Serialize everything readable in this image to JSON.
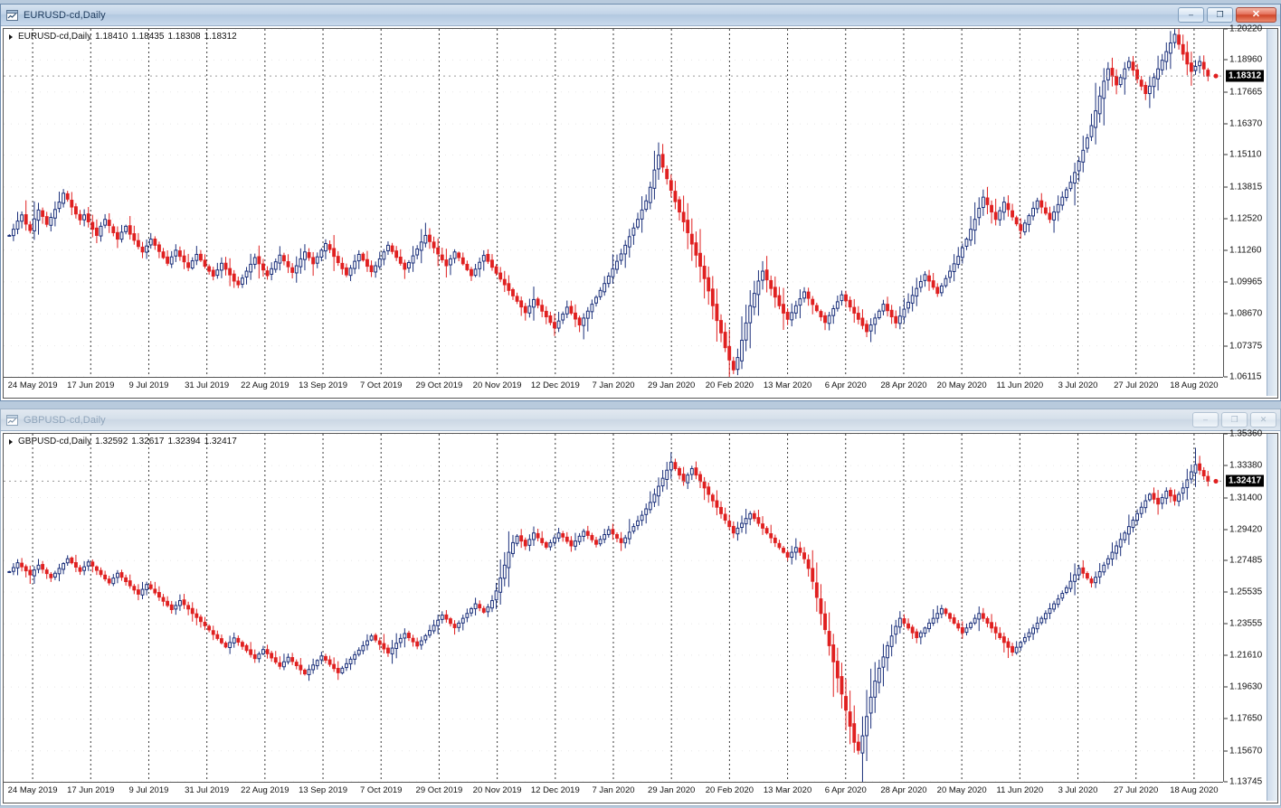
{
  "app": {
    "background_color": "#b8cadd",
    "candle_bull_color": "#1a2f7a",
    "candle_bear_color": "#e02020"
  },
  "windows": [
    {
      "id": "eurusd",
      "active": true,
      "title": "EURUSD-cd,Daily",
      "icon_name": "chart-window-icon",
      "buttons": {
        "minimize": "–",
        "restore": "❐",
        "close": "✕"
      },
      "ohlc": {
        "symbol_label": "EURUSD-cd,Daily",
        "open": "1.18410",
        "high": "1.18435",
        "low": "1.18308",
        "close": "1.18312"
      },
      "current_price": "1.18312",
      "price_labels": [
        "1.20220",
        "1.18960",
        "1.17665",
        "1.16370",
        "1.15110",
        "1.13815",
        "1.12520",
        "1.11260",
        "1.09965",
        "1.08670",
        "1.07375",
        "1.06115"
      ],
      "time_labels": [
        "24 May 2019",
        "17 Jun 2019",
        "9 Jul 2019",
        "31 Jul 2019",
        "22 Aug 2019",
        "13 Sep 2019",
        "7 Oct 2019",
        "29 Oct 2019",
        "20 Nov 2019",
        "12 Dec 2019",
        "7 Jan 2020",
        "29 Jan 2020",
        "20 Feb 2020",
        "13 Mar 2020",
        "6 Apr 2020",
        "28 Apr 2020",
        "20 May 2020",
        "11 Jun 2020",
        "3 Jul 2020",
        "27 Jul 2020",
        "18 Aug 2020"
      ]
    },
    {
      "id": "gbpusd",
      "active": false,
      "title": "GBPUSD-cd,Daily",
      "icon_name": "chart-window-icon",
      "buttons": {
        "minimize": "–",
        "restore": "❐",
        "close": "✕"
      },
      "ohlc": {
        "symbol_label": "GBPUSD-cd,Daily",
        "open": "1.32592",
        "high": "1.32617",
        "low": "1.32394",
        "close": "1.32417"
      },
      "current_price": "1.32417",
      "price_labels": [
        "1.35360",
        "1.33380",
        "1.31400",
        "1.29420",
        "1.27485",
        "1.25535",
        "1.23555",
        "1.21610",
        "1.19630",
        "1.17650",
        "1.15670",
        "1.13745"
      ],
      "time_labels": [
        "24 May 2019",
        "17 Jun 2019",
        "9 Jul 2019",
        "31 Jul 2019",
        "22 Aug 2019",
        "13 Sep 2019",
        "7 Oct 2019",
        "29 Oct 2019",
        "20 Nov 2019",
        "12 Dec 2019",
        "7 Jan 2020",
        "29 Jan 2020",
        "20 Feb 2020",
        "13 Mar 2020",
        "6 Apr 2020",
        "28 Apr 2020",
        "20 May 2020",
        "11 Jun 2020",
        "3 Jul 2020",
        "27 Jul 2020",
        "18 Aug 2020"
      ]
    }
  ],
  "chart_data": [
    {
      "type": "line",
      "chart_style": "candlestick",
      "title": "EURUSD-cd,Daily",
      "xlabel": "",
      "ylabel": "",
      "ylim": [
        1.06115,
        1.2022
      ],
      "grid": true,
      "legend": "none",
      "x_tick_labels": [
        "24 May 2019",
        "17 Jun 2019",
        "9 Jul 2019",
        "31 Jul 2019",
        "22 Aug 2019",
        "13 Sep 2019",
        "7 Oct 2019",
        "29 Oct 2019",
        "20 Nov 2019",
        "12 Dec 2019",
        "7 Jan 2020",
        "29 Jan 2020",
        "20 Feb 2020",
        "13 Mar 2020",
        "6 Apr 2020",
        "28 Apr 2020",
        "20 May 2020",
        "11 Jun 2020",
        "3 Jul 2020",
        "27 Jul 2020",
        "18 Aug 2020"
      ],
      "y_tick_labels": [
        "1.20220",
        "1.18960",
        "1.17665",
        "1.16370",
        "1.15110",
        "1.13815",
        "1.12520",
        "1.11260",
        "1.09965",
        "1.08670",
        "1.07375",
        "1.06115"
      ],
      "last_close": 1.18312,
      "close_series": [
        1.1185,
        1.121,
        1.1243,
        1.1268,
        1.1231,
        1.1205,
        1.1252,
        1.1288,
        1.1262,
        1.123,
        1.1258,
        1.129,
        1.132,
        1.1356,
        1.1332,
        1.13,
        1.1272,
        1.1248,
        1.1268,
        1.124,
        1.121,
        1.1185,
        1.1222,
        1.125,
        1.1225,
        1.1196,
        1.117,
        1.1198,
        1.1222,
        1.119,
        1.1165,
        1.114,
        1.1118,
        1.1142,
        1.117,
        1.1145,
        1.112,
        1.1095,
        1.1072,
        1.1098,
        1.1125,
        1.11,
        1.1078,
        1.1055,
        1.1082,
        1.1108,
        1.1085,
        1.106,
        1.104,
        1.102,
        1.1045,
        1.1072,
        1.1048,
        1.1025,
        1.1,
        1.0985,
        1.1012,
        1.104,
        1.1068,
        1.1095,
        1.107,
        1.1045,
        1.1022,
        1.105,
        1.1078,
        1.1105,
        1.1082,
        1.1058,
        1.1035,
        1.1062,
        1.109,
        1.1118,
        1.1095,
        1.107,
        1.1098,
        1.1125,
        1.1152,
        1.1128,
        1.11,
        1.1075,
        1.105,
        1.1025,
        1.1052,
        1.108,
        1.1108,
        1.1085,
        1.106,
        1.1038,
        1.1062,
        1.109,
        1.1118,
        1.1145,
        1.112,
        1.1096,
        1.1072,
        1.1048,
        1.1075,
        1.1102,
        1.113,
        1.1158,
        1.1185,
        1.116,
        1.1135,
        1.111,
        1.1086,
        1.1062,
        1.109,
        1.1118,
        1.1095,
        1.107,
        1.1046,
        1.1022,
        1.1048,
        1.1076,
        1.1104,
        1.108,
        1.1056,
        1.1032,
        1.1008,
        1.0985,
        1.0962,
        1.094,
        1.0918,
        1.0895,
        1.0872,
        1.0898,
        1.0925,
        1.0902,
        1.0878,
        1.0855,
        1.0832,
        1.081,
        1.0838,
        1.0866,
        1.0894,
        1.087,
        1.0846,
        1.0822,
        1.085,
        1.0878,
        1.0906,
        1.0934,
        1.0962,
        1.099,
        1.102,
        1.105,
        1.108,
        1.111,
        1.1145,
        1.118,
        1.1215,
        1.125,
        1.1288,
        1.1325,
        1.138,
        1.145,
        1.151,
        1.1462,
        1.1415,
        1.1368,
        1.1322,
        1.128,
        1.124,
        1.1196,
        1.115,
        1.1105,
        1.106,
        1.101,
        1.096,
        1.09,
        1.084,
        1.079,
        1.073,
        1.068,
        1.064,
        1.069,
        1.076,
        1.083,
        1.09,
        1.095,
        1.1,
        1.104,
        1.1005,
        1.097,
        1.0935,
        1.09,
        1.087,
        1.0845,
        1.0872,
        1.09,
        1.0928,
        1.0956,
        1.093,
        1.0905,
        1.088,
        1.0855,
        1.0832,
        1.086,
        1.0888,
        1.0916,
        1.0944,
        1.092,
        1.0895,
        1.087,
        1.0845,
        1.082,
        1.0795,
        1.0822,
        1.085,
        1.0878,
        1.0906,
        1.088,
        1.0855,
        1.083,
        1.0858,
        1.0886,
        1.0914,
        1.0942,
        1.097,
        1.0998,
        1.1026,
        1.1,
        1.0975,
        1.095,
        1.098,
        1.101,
        1.104,
        1.107,
        1.11,
        1.1135,
        1.117,
        1.121,
        1.125,
        1.1295,
        1.134,
        1.131,
        1.128,
        1.125,
        1.1285,
        1.132,
        1.129,
        1.126,
        1.1232,
        1.1205,
        1.1235,
        1.1265,
        1.1295,
        1.1325,
        1.13,
        1.1275,
        1.125,
        1.128,
        1.131,
        1.134,
        1.137,
        1.14,
        1.144,
        1.1485,
        1.153,
        1.158,
        1.163,
        1.169,
        1.175,
        1.181,
        1.186,
        1.183,
        1.1795,
        1.1825,
        1.186,
        1.189,
        1.1855,
        1.182,
        1.179,
        1.176,
        1.179,
        1.1825,
        1.186,
        1.1895,
        1.193,
        1.1965,
        1.2,
        1.196,
        1.192,
        1.188,
        1.185,
        1.187,
        1.189,
        1.186,
        1.1831
      ]
    },
    {
      "type": "line",
      "chart_style": "candlestick",
      "title": "GBPUSD-cd,Daily",
      "xlabel": "",
      "ylabel": "",
      "ylim": [
        1.13745,
        1.3536
      ],
      "grid": true,
      "legend": "none",
      "x_tick_labels": [
        "24 May 2019",
        "17 Jun 2019",
        "9 Jul 2019",
        "31 Jul 2019",
        "22 Aug 2019",
        "13 Sep 2019",
        "7 Oct 2019",
        "29 Oct 2019",
        "20 Nov 2019",
        "12 Dec 2019",
        "7 Jan 2020",
        "29 Jan 2020",
        "20 Feb 2020",
        "13 Mar 2020",
        "6 Apr 2020",
        "28 Apr 2020",
        "20 May 2020",
        "11 Jun 2020",
        "3 Jul 2020",
        "27 Jul 2020",
        "18 Aug 2020"
      ],
      "y_tick_labels": [
        "1.35360",
        "1.33380",
        "1.31400",
        "1.29420",
        "1.27485",
        "1.25535",
        "1.23555",
        "1.21610",
        "1.19630",
        "1.17650",
        "1.15670",
        "1.13745"
      ],
      "last_close": 1.32417,
      "close_series": [
        1.268,
        1.2705,
        1.2735,
        1.271,
        1.2685,
        1.266,
        1.269,
        1.272,
        1.2695,
        1.2668,
        1.2642,
        1.267,
        1.27,
        1.273,
        1.276,
        1.2735,
        1.2708,
        1.2682,
        1.271,
        1.274,
        1.2715,
        1.2688,
        1.2662,
        1.2635,
        1.261,
        1.264,
        1.267,
        1.2645,
        1.2618,
        1.2592,
        1.2566,
        1.254,
        1.257,
        1.26,
        1.2575,
        1.2548,
        1.2522,
        1.2496,
        1.247,
        1.2444,
        1.247,
        1.25,
        1.2475,
        1.2448,
        1.242,
        1.2395,
        1.237,
        1.2344,
        1.2318,
        1.229,
        1.2265,
        1.2238,
        1.2212,
        1.224,
        1.2268,
        1.2242,
        1.2216,
        1.219,
        1.2165,
        1.214,
        1.2168,
        1.2196,
        1.217,
        1.2144,
        1.2118,
        1.2092,
        1.212,
        1.2148,
        1.2122,
        1.2096,
        1.207,
        1.2045,
        1.2072,
        1.21,
        1.2128,
        1.2156,
        1.213,
        1.2104,
        1.2078,
        1.2052,
        1.208,
        1.2108,
        1.2136,
        1.2164,
        1.2192,
        1.222,
        1.225,
        1.228,
        1.2255,
        1.2228,
        1.22,
        1.2175,
        1.2205,
        1.2235,
        1.2265,
        1.2295,
        1.227,
        1.2244,
        1.2218,
        1.225,
        1.2282,
        1.2314,
        1.2346,
        1.2378,
        1.241,
        1.2385,
        1.2358,
        1.2332,
        1.236,
        1.239,
        1.242,
        1.245,
        1.248,
        1.2455,
        1.2428,
        1.246,
        1.25,
        1.256,
        1.264,
        1.272,
        1.28,
        1.286,
        1.29,
        1.287,
        1.284,
        1.288,
        1.292,
        1.289,
        1.286,
        1.2832,
        1.286,
        1.289,
        1.292,
        1.2895,
        1.2868,
        1.284,
        1.287,
        1.29,
        1.293,
        1.2905,
        1.2878,
        1.285,
        1.288,
        1.291,
        1.294,
        1.2915,
        1.2888,
        1.286,
        1.289,
        1.2925,
        1.296,
        1.2995,
        1.303,
        1.307,
        1.311,
        1.316,
        1.321,
        1.326,
        1.331,
        1.336,
        1.332,
        1.328,
        1.324,
        1.328,
        1.332,
        1.328,
        1.324,
        1.32,
        1.316,
        1.312,
        1.308,
        1.304,
        1.3,
        1.296,
        1.292,
        1.295,
        1.298,
        1.301,
        1.304,
        1.301,
        1.298,
        1.295,
        1.292,
        1.289,
        1.286,
        1.283,
        1.28,
        1.277,
        1.28,
        1.283,
        1.28,
        1.276,
        1.27,
        1.262,
        1.252,
        1.242,
        1.232,
        1.222,
        1.212,
        1.202,
        1.192,
        1.182,
        1.172,
        1.162,
        1.157,
        1.166,
        1.178,
        1.19,
        1.2,
        1.208,
        1.215,
        1.222,
        1.228,
        1.234,
        1.239,
        1.236,
        1.233,
        1.23,
        1.227,
        1.23,
        1.233,
        1.236,
        1.239,
        1.242,
        1.245,
        1.242,
        1.239,
        1.236,
        1.233,
        1.23,
        1.233,
        1.236,
        1.239,
        1.242,
        1.239,
        1.236,
        1.233,
        1.23,
        1.227,
        1.224,
        1.221,
        1.218,
        1.221,
        1.224,
        1.227,
        1.23,
        1.233,
        1.236,
        1.239,
        1.242,
        1.245,
        1.248,
        1.251,
        1.2545,
        1.258,
        1.262,
        1.266,
        1.27,
        1.267,
        1.264,
        1.261,
        1.2645,
        1.268,
        1.272,
        1.276,
        1.28,
        1.284,
        1.288,
        1.292,
        1.296,
        1.3,
        1.304,
        1.308,
        1.312,
        1.316,
        1.313,
        1.31,
        1.314,
        1.318,
        1.315,
        1.312,
        1.316,
        1.32,
        1.325,
        1.33,
        1.3345,
        1.331,
        1.3275,
        1.3242
      ]
    }
  ]
}
